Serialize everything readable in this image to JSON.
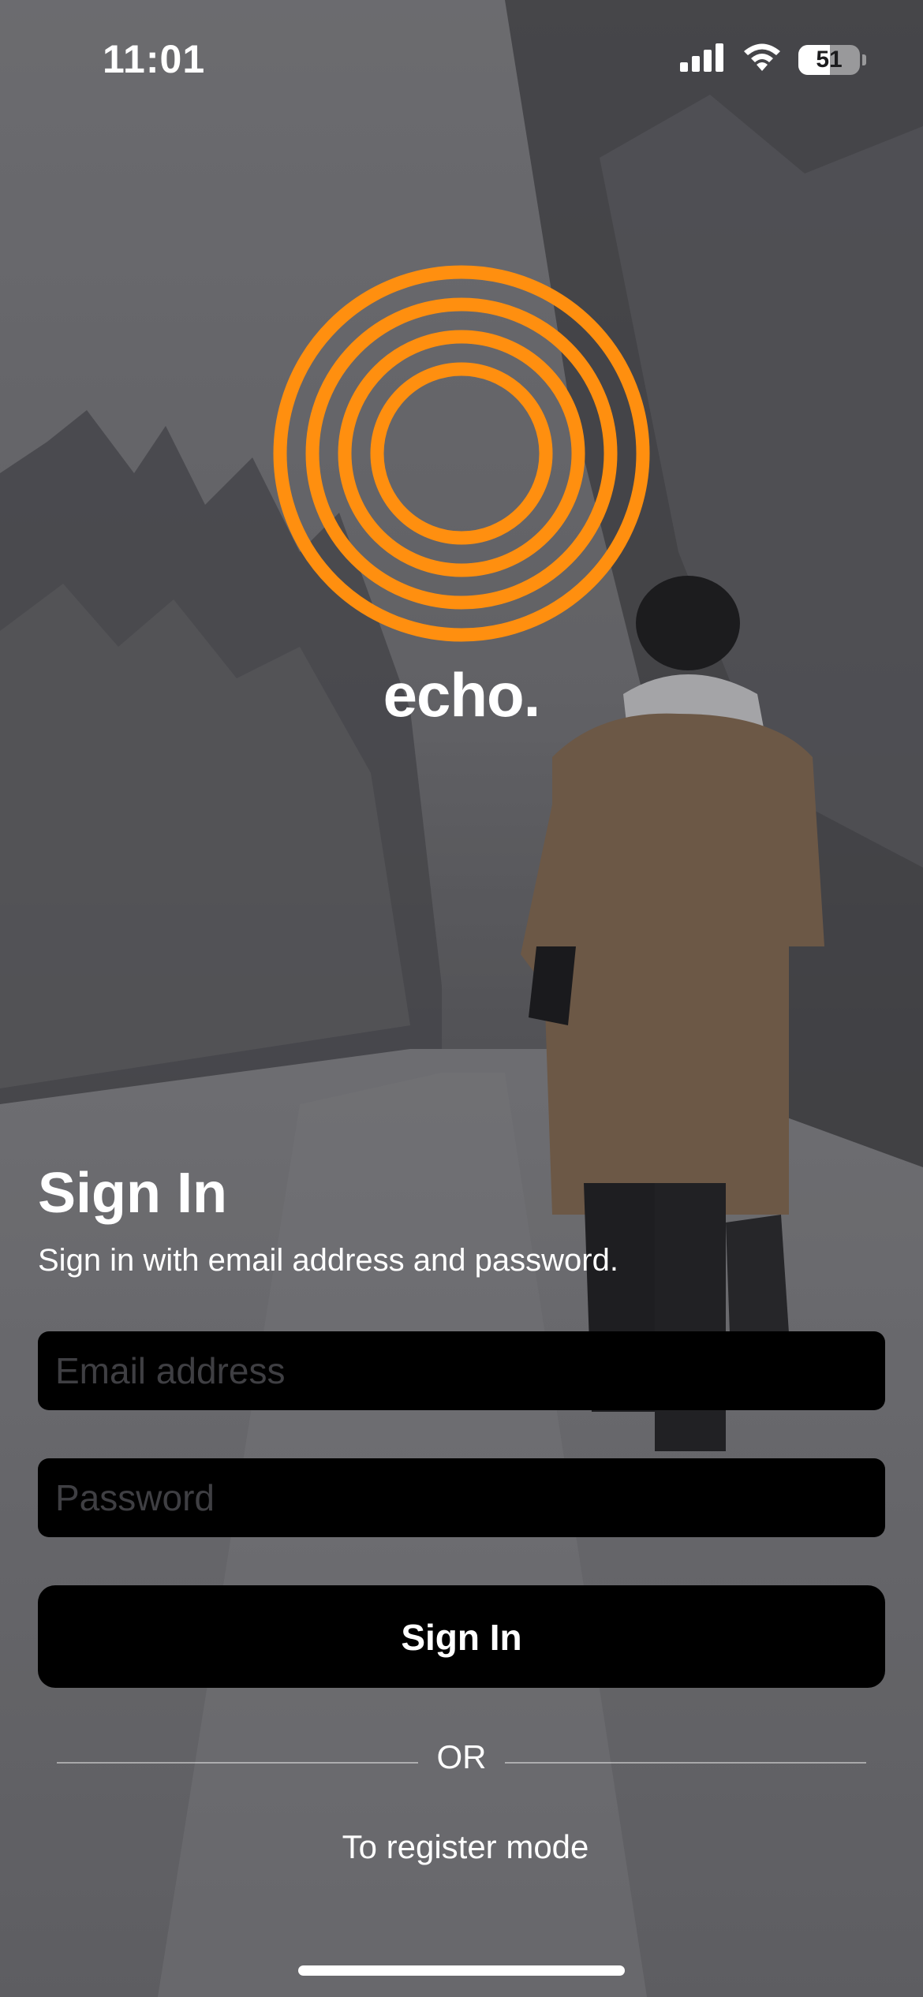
{
  "status_bar": {
    "time": "11:01",
    "battery_level": "51",
    "battery_fraction": 0.51,
    "icons": [
      "cellular-signal-icon",
      "wifi-icon",
      "battery-icon"
    ]
  },
  "brand": {
    "name": "echo.",
    "logo_icon": "concentric-rings-logo",
    "accent_color": "#FF8F0F"
  },
  "signin": {
    "heading": "Sign In",
    "subheading": "Sign in with email address and password.",
    "email_placeholder": "Email address",
    "email_value": "",
    "password_placeholder": "Password",
    "password_value": "",
    "button_label": "Sign In"
  },
  "divider": {
    "label": "OR"
  },
  "register": {
    "label": "To register mode"
  }
}
